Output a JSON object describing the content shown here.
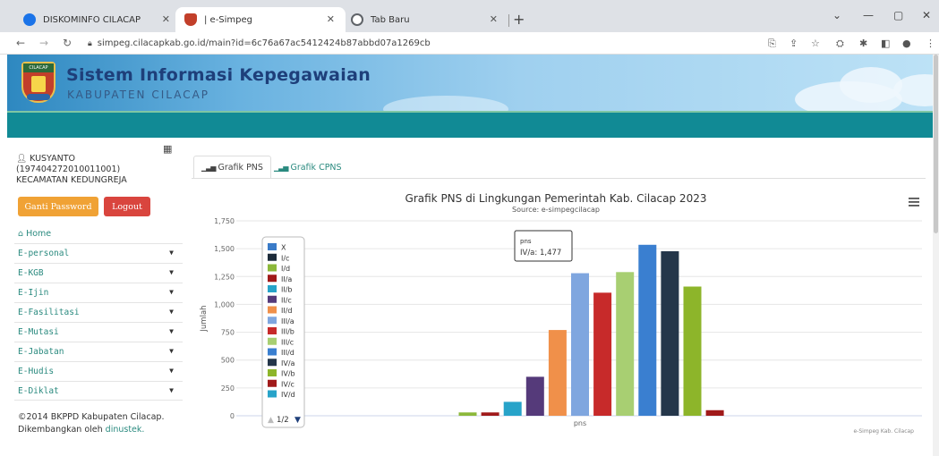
{
  "browser": {
    "tabs": [
      {
        "title": "DISKOMINFO CILACAP",
        "color": "#1a73e8"
      },
      {
        "title": "| e-Simpeg",
        "color": "#c23f2a"
      },
      {
        "title": "Tab Baru",
        "color": "#5f6368"
      }
    ],
    "url": "simpeg.cilacapkab.go.id/main?id=6c76a67ac5412424b87abbd07a1269cb"
  },
  "banner": {
    "title": "Sistem Informasi Kepegawaian",
    "subtitle": "KABUPATEN CILACAP",
    "logo_text": "CILACAP"
  },
  "sidebar": {
    "user_name": "KUSYANTO",
    "user_nip": "(197404272010011001)",
    "user_unit": "KECAMATAN KEDUNGREJA",
    "ganti_password": "Ganti Password",
    "logout": "Logout",
    "home": "Home",
    "menu": [
      "E-personal",
      "E-KGB",
      "E-Ijin",
      "E-Fasilitasi",
      "E-Mutasi",
      "E-Jabatan",
      "E-Hudis",
      "E-Diklat"
    ],
    "footer_line1": "©2014 BKPPD Kabupaten Cilacap.",
    "footer_line2_prefix": "Dikembangkan oleh",
    "footer_link": "dinustek."
  },
  "content": {
    "tab_pns": "Grafik PNS",
    "tab_cpns": "Grafik CPNS"
  },
  "chart_data": {
    "type": "bar",
    "title": "Grafik PNS di Lingkungan Pemerintah Kab. Cilacap 2023",
    "subtitle": "Source: e-simpegcilacap",
    "ylabel": "Jumlah",
    "xlabel": "",
    "categories": [
      "pns"
    ],
    "ylim": [
      0,
      1750
    ],
    "yticks": [
      0,
      250,
      500,
      750,
      1000,
      1250,
      1500,
      1750
    ],
    "series": [
      {
        "name": "X",
        "value": 0,
        "color": "#3a7bc8"
      },
      {
        "name": "I/c",
        "value": 0,
        "color": "#1c2b3a"
      },
      {
        "name": "I/d",
        "value": 30,
        "color": "#8cb83a"
      },
      {
        "name": "II/a",
        "value": 30,
        "color": "#a01a1a"
      },
      {
        "name": "II/b",
        "value": 125,
        "color": "#27a3c9"
      },
      {
        "name": "II/c",
        "value": 350,
        "color": "#553a7a"
      },
      {
        "name": "II/d",
        "value": 770,
        "color": "#f0904a"
      },
      {
        "name": "III/a",
        "value": 1280,
        "color": "#7fa6df"
      },
      {
        "name": "III/b",
        "value": 1105,
        "color": "#c72a2a"
      },
      {
        "name": "III/c",
        "value": 1290,
        "color": "#a8cf72"
      },
      {
        "name": "III/d",
        "value": 1535,
        "color": "#3a7fd0"
      },
      {
        "name": "IV/a",
        "value": 1477,
        "color": "#24364a"
      },
      {
        "name": "IV/b",
        "value": 1160,
        "color": "#8db52a"
      },
      {
        "name": "IV/c",
        "value": 50,
        "color": "#a01a1a"
      },
      {
        "name": "IV/d",
        "value": 0,
        "color": "#27a3c9"
      }
    ],
    "legend_page": "1/2",
    "tooltip": {
      "category": "pns",
      "series": "IV/a",
      "value": "1,477"
    },
    "credits": "e-Simpeg Kab. Cilacap"
  }
}
